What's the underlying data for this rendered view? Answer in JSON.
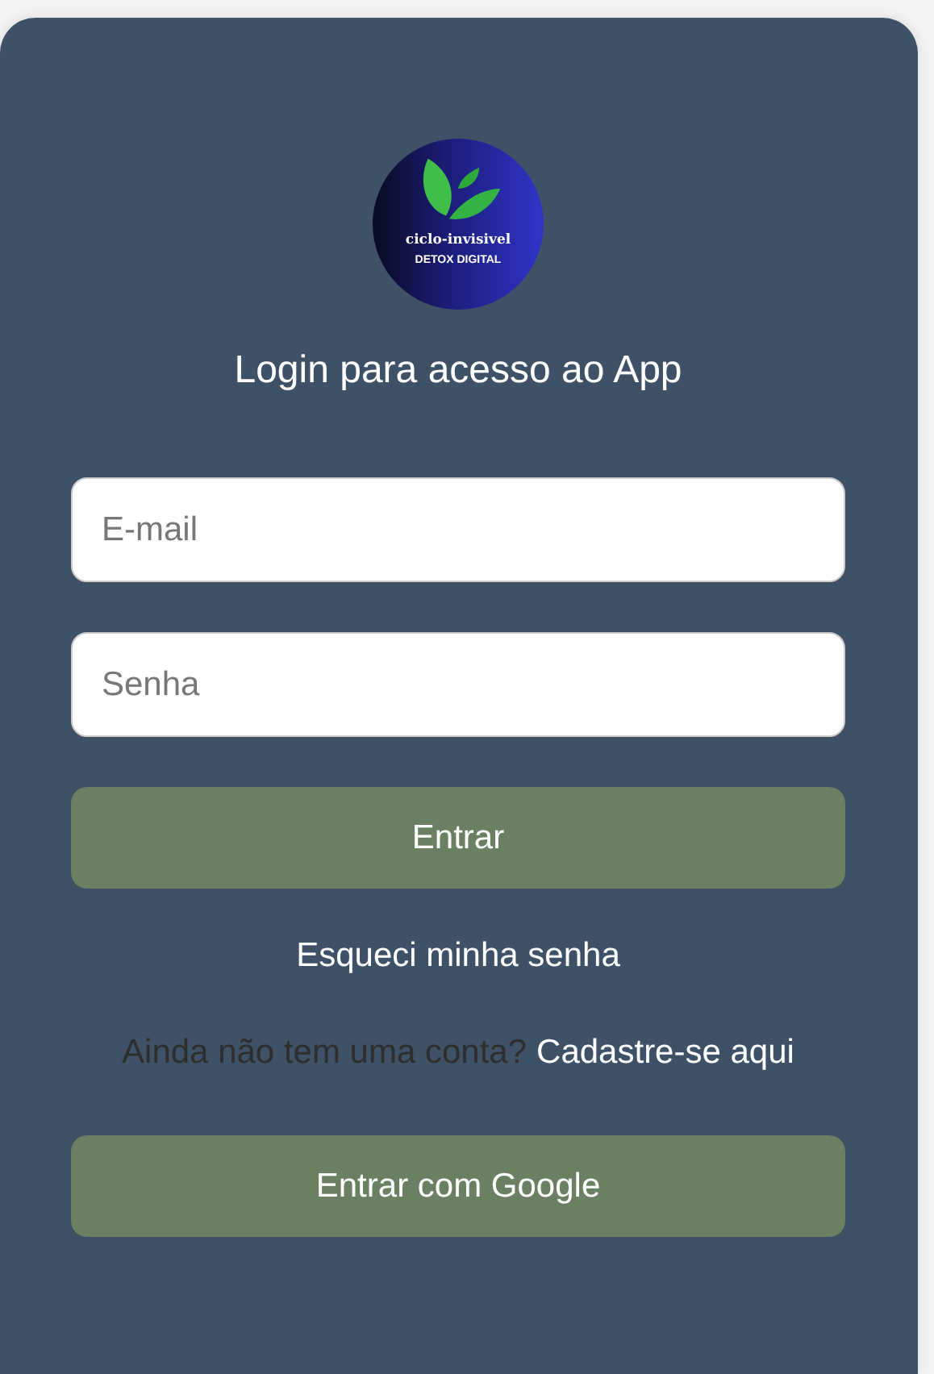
{
  "logo": {
    "name": "ciclo-invisivel",
    "tagline": "DETOX DIGITAL"
  },
  "title": "Login para acesso ao App",
  "fields": [
    {
      "placeholder": "E-mail"
    },
    {
      "placeholder": "Senha"
    }
  ],
  "login_button": "Entrar",
  "forgot_link": "Esqueci minha senha",
  "signup": {
    "prompt": "Ainda não tem uma conta?",
    "link": "Cadastre-se aqui"
  },
  "google_button": "Entrar com Google"
}
